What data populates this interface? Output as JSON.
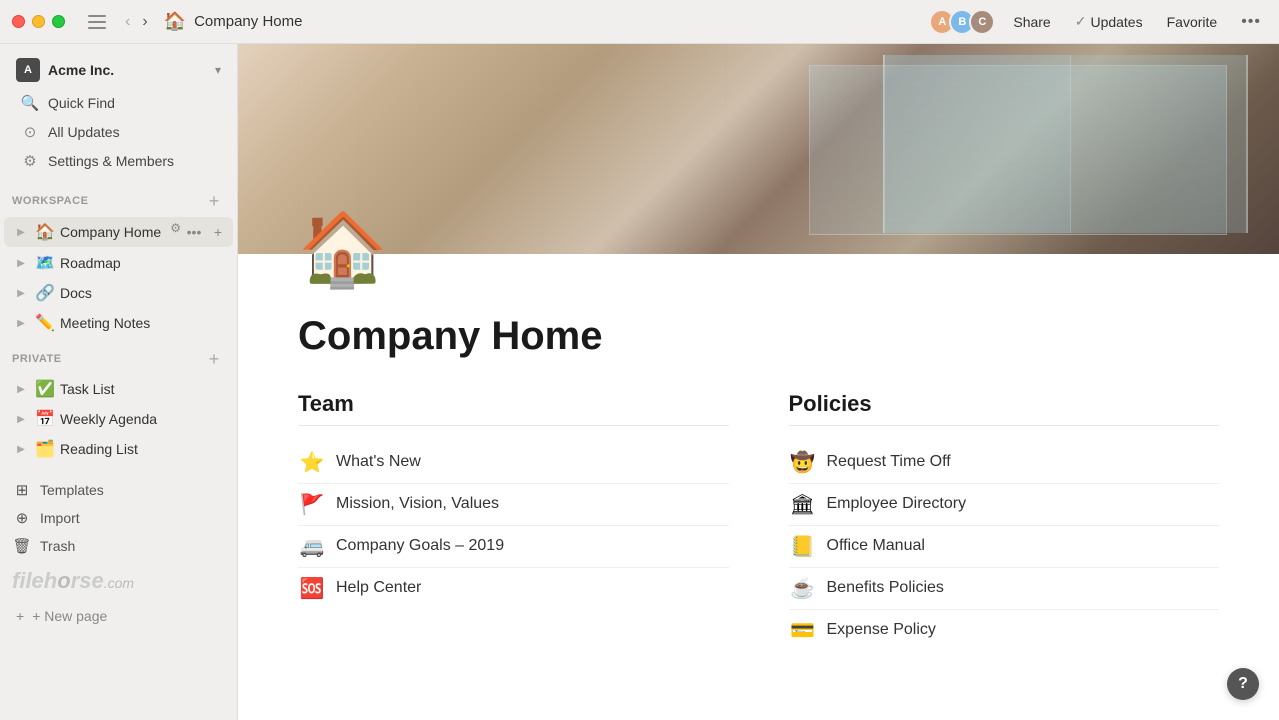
{
  "titlebar": {
    "back_label": "‹",
    "forward_label": "›",
    "page_icon": "🏠",
    "page_title": "Company Home",
    "share_label": "Share",
    "updates_label": "Updates",
    "favorite_label": "Favorite",
    "more_label": "•••"
  },
  "sidebar": {
    "workspace": {
      "name": "Acme Inc.",
      "avatar": "A",
      "chevron": "▾"
    },
    "menu": [
      {
        "id": "quick-find",
        "icon": "🔍",
        "label": "Quick Find"
      },
      {
        "id": "all-updates",
        "icon": "⊙",
        "label": "All Updates"
      },
      {
        "id": "settings",
        "icon": "⚙",
        "label": "Settings & Members"
      }
    ],
    "workspace_section": "WORKSPACE",
    "workspace_items": [
      {
        "id": "company-home",
        "icon": "🏠",
        "label": "Company Home",
        "active": true
      },
      {
        "id": "roadmap",
        "icon": "🗺️",
        "label": "Roadmap"
      },
      {
        "id": "docs",
        "icon": "🔗",
        "label": "Docs"
      },
      {
        "id": "meeting-notes",
        "icon": "✏️",
        "label": "Meeting Notes"
      }
    ],
    "private_section": "PRIVATE",
    "private_items": [
      {
        "id": "task-list",
        "icon": "✅",
        "label": "Task List"
      },
      {
        "id": "weekly-agenda",
        "icon": "📅",
        "label": "Weekly Agenda"
      },
      {
        "id": "reading-list",
        "icon": "🗂️",
        "label": "Reading List"
      }
    ],
    "bottom_items": [
      {
        "id": "templates",
        "icon": "⊞",
        "label": "Templates"
      },
      {
        "id": "import",
        "icon": "⊕",
        "label": "Import"
      },
      {
        "id": "trash",
        "icon": "🗑",
        "label": "Trash"
      }
    ],
    "new_page_label": "+ New page"
  },
  "main": {
    "page_emoji": "🏠",
    "page_title": "Company Home",
    "team_section": {
      "heading": "Team",
      "links": [
        {
          "emoji": "⭐",
          "label": "What's New"
        },
        {
          "emoji": "🚩",
          "label": "Mission, Vision, Values"
        },
        {
          "emoji": "🚐",
          "label": "Company Goals – 2019"
        },
        {
          "emoji": "🆘",
          "label": "Help Center"
        }
      ]
    },
    "policies_section": {
      "heading": "Policies",
      "links": [
        {
          "emoji": "🤠",
          "label": "Request Time Off"
        },
        {
          "emoji": "🏛",
          "label": "Employee Directory"
        },
        {
          "emoji": "📒",
          "label": "Office Manual"
        },
        {
          "emoji": "☕",
          "label": "Benefits Policies"
        },
        {
          "emoji": "💳",
          "label": "Expense Policy"
        }
      ]
    }
  },
  "help": {
    "label": "?"
  }
}
